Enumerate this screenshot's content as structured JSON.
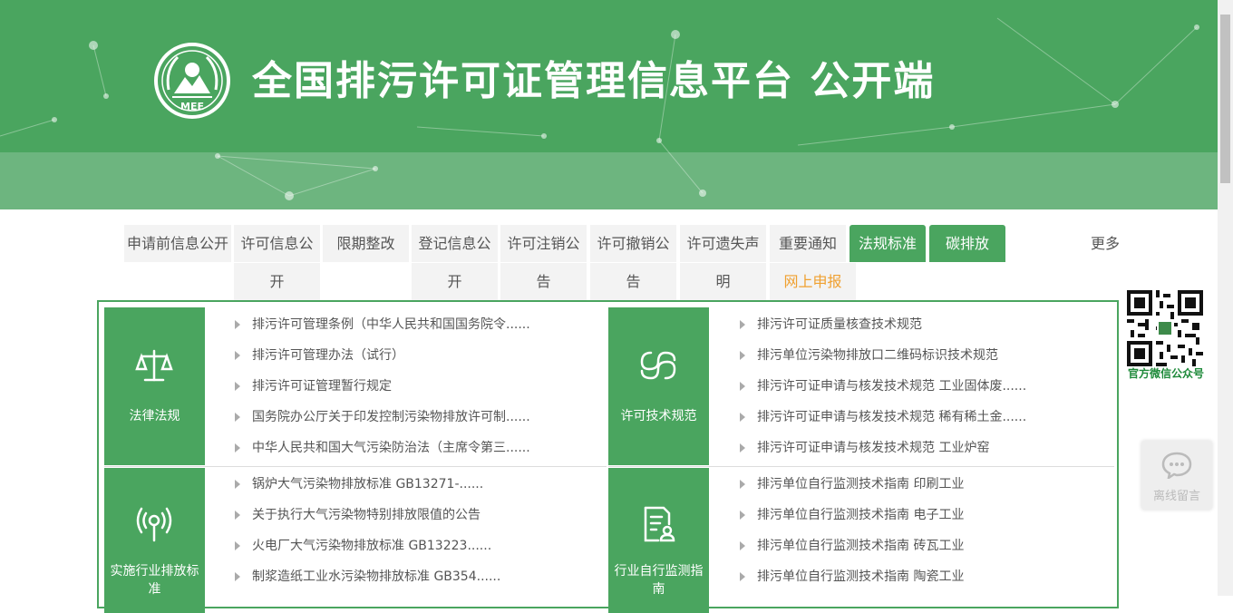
{
  "header": {
    "logo_text": "MEE",
    "title": "全国排污许可证管理信息平台  公开端"
  },
  "nav": {
    "tabs": [
      {
        "line1": "申请前信息公开",
        "line2": ""
      },
      {
        "line1": "许可信息公",
        "line2": "开"
      },
      {
        "line1": "限期整改",
        "line2": ""
      },
      {
        "line1": "登记信息公",
        "line2": "开"
      },
      {
        "line1": "许可注销公",
        "line2": "告"
      },
      {
        "line1": "许可撤销公",
        "line2": "告"
      },
      {
        "line1": "许可遗失声",
        "line2": "明"
      },
      {
        "line1": "重要通知",
        "line2": "网上申报"
      },
      {
        "line1": "法规标准",
        "line2": ""
      },
      {
        "line1": "碳排放",
        "line2": ""
      }
    ],
    "more": "更多"
  },
  "sections": [
    {
      "title": "法律法规",
      "icon": "scale-icon",
      "items": [
        "排污许可管理条例（中华人民共和国国务院令......",
        "排污许可管理办法（试行）",
        "排污许可证管理暂行规定",
        "国务院办公厅关于印发控制污染物排放许可制......",
        "中华人民共和国大气污染防治法（主席令第三......"
      ]
    },
    {
      "title": "许可技术规范",
      "icon": "link-icon",
      "items": [
        "排污许可证质量核查技术规范",
        "排污单位污染物排放口二维码标识技术规范",
        "排污许可证申请与核发技术规范 工业固体废......",
        "排污许可证申请与核发技术规范 稀有稀土金......",
        "排污许可证申请与核发技术规范 工业炉窑"
      ]
    },
    {
      "title_line1": "实施行业排放标",
      "title_line2": "准",
      "icon": "broadcast-icon",
      "items": [
        "锅炉大气污染物排放标准 GB13271-......",
        "关于执行大气污染物特别排放限值的公告",
        "火电厂大气污染物排放标准 GB13223......",
        "制浆造纸工业水污染物排放标准 GB354......"
      ]
    },
    {
      "title_line1": "行业自行监测指",
      "title_line2": "南",
      "icon": "document-user-icon",
      "items": [
        "排污单位自行监测技术指南 印刷工业",
        "排污单位自行监测技术指南 电子工业",
        "排污单位自行监测技术指南 砖瓦工业",
        "排污单位自行监测技术指南 陶瓷工业"
      ]
    }
  ],
  "sidebar": {
    "qr_label": "官方微信公众号",
    "message_label": "离线留言"
  },
  "colors": {
    "brand_green": "#4aa55f",
    "notice_orange": "#f0a030",
    "qr_label_green": "#1e8a3a"
  }
}
